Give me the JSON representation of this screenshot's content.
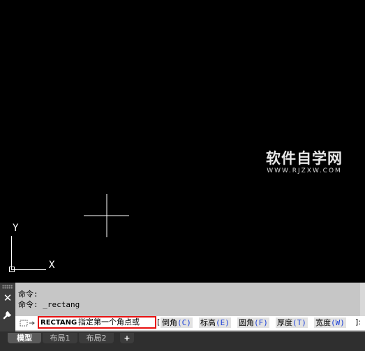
{
  "watermark": {
    "main": "软件自学网",
    "sub": "WWW.RJZXW.COM"
  },
  "ucs": {
    "y_label": "Y",
    "x_label": "X"
  },
  "command_history": [
    "命令:",
    "命令: _rectang"
  ],
  "command_prompt": {
    "command": "RECTANG",
    "text": "指定第一个角点或",
    "bracket_open": "[",
    "bracket_close": "]:",
    "options": [
      {
        "label": "倒角",
        "key": "(C)"
      },
      {
        "label": "标高",
        "key": "(E)"
      },
      {
        "label": "圆角",
        "key": "(F)"
      },
      {
        "label": "厚度",
        "key": "(T)"
      },
      {
        "label": "宽度",
        "key": "(W)"
      }
    ]
  },
  "tabs": {
    "model": "模型",
    "layout1": "布局1",
    "layout2": "布局2",
    "add": "+"
  },
  "panel_buttons": {
    "close": "✕"
  },
  "colors": {
    "canvas": "#000000",
    "highlight_box": "#e81010",
    "option_key": "#1a3fd8",
    "arrow": "#e81010"
  }
}
